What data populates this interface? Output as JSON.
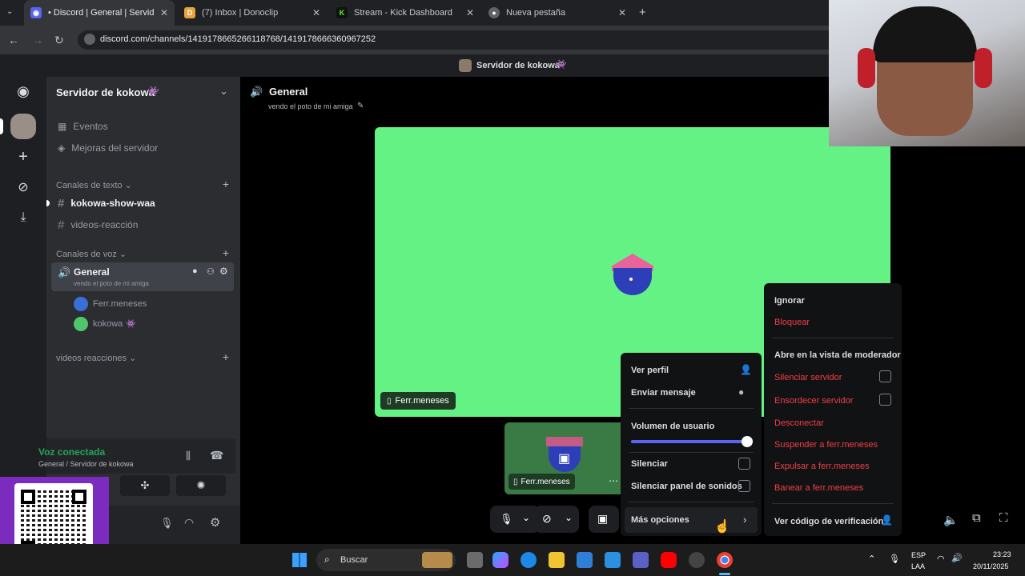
{
  "browser": {
    "tabs": [
      {
        "title": "• Discord | General | Servid",
        "active": true,
        "icon": "discord-icon"
      },
      {
        "title": "(7) Inbox | Donoclip",
        "active": false,
        "icon": "donoclip-icon"
      },
      {
        "title": "Stream - Kick Dashboard",
        "active": false,
        "icon": "kick-icon"
      },
      {
        "title": "Nueva pestaña",
        "active": false,
        "icon": "chrome-icon"
      }
    ],
    "url": "discord.com/channels/1419178665266118768/1419178666360967252"
  },
  "server": {
    "title": "Servidor de kokowa",
    "top_title": "Servidor de kokowa",
    "menu": [
      {
        "label": "Eventos",
        "icon": "calendar-icon"
      },
      {
        "label": "Mejoras del servidor",
        "icon": "boost-icon"
      }
    ],
    "text_category": "Canales de texto",
    "text_channels": [
      "kokowa-show-waa",
      "videos-reacción"
    ],
    "voice_category": "Canales de voz",
    "voice_channel": {
      "name": "General",
      "status": "vendo el poto de mi amiga"
    },
    "voice_members": [
      "Ferr.meneses",
      "kokowa"
    ],
    "other_category": "videos reacciones"
  },
  "voice_panel": {
    "status": "Voz conectada",
    "location": "General / Servidor de kokowa"
  },
  "channel_header": {
    "name": "General",
    "status": "vendo el poto de mi amiga"
  },
  "stage": {
    "main_tile_name": "Ferr.meneses",
    "thumb_name": "Ferr.meneses",
    "tile_color": "#65f284"
  },
  "context_menu": {
    "items": [
      {
        "label": "Ver perfil",
        "icon": "user-icon"
      },
      {
        "label": "Enviar mensaje",
        "icon": "chat-icon"
      }
    ],
    "volume_label": "Volumen de usuario",
    "volume_level": 1.0,
    "checks": [
      "Silenciar",
      "Silenciar panel de sonidos"
    ],
    "more": "Más opciones"
  },
  "submenu": {
    "ignore": "Ignorar",
    "block": "Bloquear",
    "moderator_view": "Abre en la vista de moderador",
    "server_mute": "Silenciar servidor",
    "server_deafen": "Ensordecer servidor",
    "disconnect": "Desconectar",
    "suspend": "Suspender a ferr.meneses",
    "kick": "Expulsar a ferr.meneses",
    "ban": "Banear a ferr.meneses",
    "verify": "Ver código de verificación"
  },
  "taskbar": {
    "search": "Buscar",
    "lang_top": "ESP",
    "lang_bottom": "LAA",
    "time": "23:23",
    "date": "20/11/2025"
  },
  "colors": {
    "accent": "#5865f2",
    "danger": "#f23f43",
    "voice_green": "#23a55a"
  }
}
